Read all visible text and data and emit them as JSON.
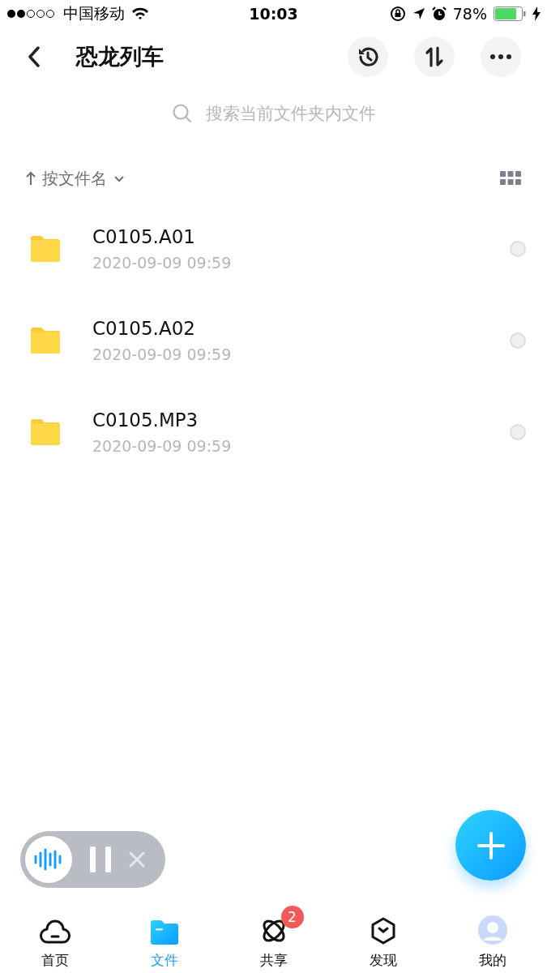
{
  "status_bar": {
    "carrier": "中国移动",
    "time": "10:03",
    "battery": "78%"
  },
  "header": {
    "title": "恐龙列车"
  },
  "search": {
    "placeholder": "搜索当前文件夹内文件"
  },
  "sort": {
    "label": "按文件名"
  },
  "files": [
    {
      "name": "C0105.A01",
      "date": "2020-09-09 09:59",
      "selected": false
    },
    {
      "name": "C0105.A02",
      "date": "2020-09-09 09:59",
      "selected": false
    },
    {
      "name": "C0105.MP3",
      "date": "2020-09-09 09:59",
      "selected": false
    }
  ],
  "tabs": [
    {
      "label": "首页",
      "kind": "cloud",
      "selected": false
    },
    {
      "label": "文件",
      "kind": "folder",
      "selected": true
    },
    {
      "label": "共享",
      "kind": "orbit",
      "selected": false,
      "badge": "2"
    },
    {
      "label": "发现",
      "kind": "box",
      "selected": false
    },
    {
      "label": "我的",
      "kind": "avatar",
      "selected": false
    }
  ]
}
